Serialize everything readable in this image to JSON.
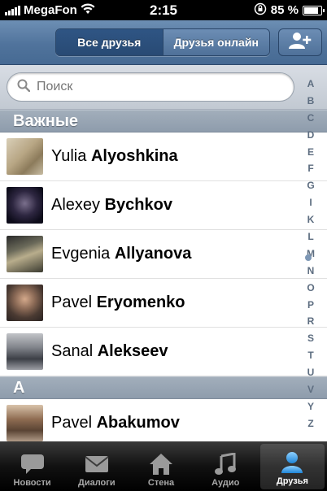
{
  "status": {
    "carrier": "MegaFon",
    "time": "2:15",
    "battery": "85 %",
    "battery_level": 0.85
  },
  "nav": {
    "segment_all": "Все друзья",
    "segment_online": "Друзья онлайн",
    "add_icon": "add-person-icon"
  },
  "search": {
    "placeholder": "Поиск"
  },
  "sections": [
    {
      "header": "Важные",
      "rows": [
        {
          "first": "Yulia",
          "last": "Alyoshkina"
        },
        {
          "first": "Alexey",
          "last": "Bychkov"
        },
        {
          "first": "Evgenia",
          "last": "Allyanova"
        },
        {
          "first": "Pavel",
          "last": "Eryomenko"
        },
        {
          "first": "Sanal",
          "last": "Alekseev"
        }
      ]
    },
    {
      "header": "A",
      "rows": [
        {
          "first": "Pavel",
          "last": "Abakumov"
        }
      ]
    }
  ],
  "index": [
    "A",
    "B",
    "C",
    "D",
    "E",
    "F",
    "G",
    "I",
    "K",
    "L",
    "M",
    "N",
    "O",
    "P",
    "R",
    "S",
    "T",
    "U",
    "V",
    "Y",
    "Z"
  ],
  "tabs": [
    {
      "label": "Новости",
      "icon": "news-bubble-icon"
    },
    {
      "label": "Диалоги",
      "icon": "envelope-icon"
    },
    {
      "label": "Стена",
      "icon": "home-icon"
    },
    {
      "label": "Аудио",
      "icon": "music-note-icon"
    },
    {
      "label": "Друзья",
      "icon": "friends-icon",
      "active": true
    }
  ],
  "colors": {
    "navbar": "#50739c",
    "active_segment": "#284a74",
    "section_header": "#8e9cac",
    "tabbar": "#000000"
  }
}
